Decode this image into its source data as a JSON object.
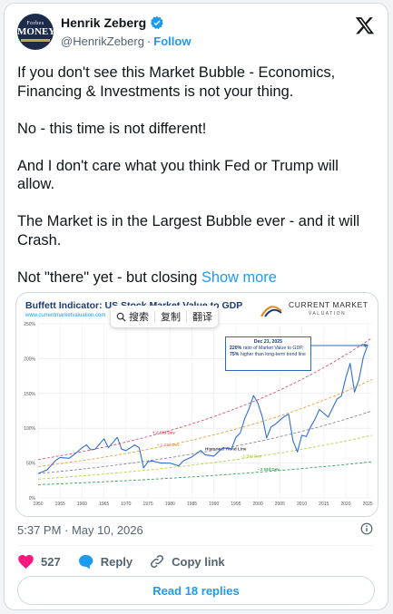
{
  "author": {
    "name": "Henrik Zeberg",
    "handle": "@HenrikZeberg",
    "separator": "·",
    "follow_label": "Follow",
    "avatar_text_top": "Forbes",
    "avatar_text_main": "MONEY"
  },
  "tweet": {
    "paragraphs": [
      "If you don't see this Market Bubble - Economics, Financing & Investments is not your thing.",
      "No - this time is not different!",
      "And I don't care what you think Fed or Trump will allow.",
      "The Market is in the Largest Bubble ever - and it will Crash."
    ],
    "last_line": "Not \"there\" yet - but closing",
    "show_more": "Show more"
  },
  "media": {
    "title": "Buffett Indicator: US Stock Market Value to GDP",
    "url": "www.currentmarketvaluation.com",
    "logo_line1": "CURRENT MARKET",
    "logo_line2": "VALUATION",
    "popup": {
      "search": "搜索",
      "copy": "复制",
      "translate": "翻译"
    },
    "annotation": {
      "date": "Dec 21, 2025",
      "line1_bold": "220%",
      "line1_rest": " ratio of Market Value to GDP,",
      "line2_bold": "75%",
      "line2_rest": " higher than long-term trend line"
    }
  },
  "chart_data": {
    "type": "line",
    "title": "Buffett Indicator: US Stock Market Value to GDP",
    "xlim": [
      1950,
      2026
    ],
    "ylim": [
      0,
      250
    ],
    "x_ticks": [
      "1950",
      "1955",
      "1960",
      "1965",
      "1970",
      "1975",
      "1980",
      "1985",
      "1990",
      "1995",
      "2000",
      "2005",
      "2010",
      "2015",
      "2020",
      "2025"
    ],
    "y_ticks": [
      "0%",
      "50%",
      "100%",
      "150%",
      "200%",
      "250%"
    ],
    "grid": true,
    "bands": [
      {
        "name": "+ 2 Std Dev",
        "color": "#d9536b",
        "start": 55,
        "end": 230
      },
      {
        "name": "+ 1 Std Dev",
        "color": "#e8a03a",
        "start": 45,
        "end": 170
      },
      {
        "name": "Historical Trend Line",
        "color": "#888888",
        "start": 35,
        "end": 125
      },
      {
        "name": "- 1 Std Dev",
        "color": "#b6cf4a",
        "start": 27,
        "end": 90
      },
      {
        "name": "- 2 Std Dev",
        "color": "#3aa05a",
        "start": 19,
        "end": 52
      }
    ],
    "series": [
      {
        "color": "#2f6fd1",
        "x": [
          1950,
          1952,
          1954,
          1955,
          1957,
          1958,
          1960,
          1961,
          1962,
          1963,
          1965,
          1966,
          1968,
          1969,
          1970,
          1972,
          1973,
          1974,
          1975,
          1976,
          1978,
          1980,
          1982,
          1983,
          1985,
          1987,
          1988,
          1990,
          1992,
          1994,
          1995,
          1996,
          1997,
          1998,
          1999,
          2000,
          2001,
          2002,
          2003,
          2004,
          2006,
          2007,
          2008,
          2009,
          2010,
          2011,
          2012,
          2013,
          2014,
          2016,
          2018,
          2019,
          2020,
          2021,
          2022,
          2023,
          2024,
          2025
        ],
        "y": [
          35,
          42,
          52,
          60,
          55,
          63,
          70,
          78,
          67,
          72,
          83,
          74,
          85,
          72,
          66,
          78,
          70,
          45,
          50,
          55,
          48,
          52,
          44,
          55,
          57,
          70,
          60,
          62,
          70,
          72,
          85,
          95,
          112,
          130,
          145,
          138,
          115,
          88,
          100,
          108,
          115,
          122,
          80,
          68,
          88,
          90,
          100,
          115,
          125,
          118,
          140,
          148,
          170,
          195,
          150,
          172,
          200,
          220
        ]
      }
    ]
  },
  "footer": {
    "timestamp": "5:37 PM · May 10, 2026",
    "likes": "527",
    "reply_label": "Reply",
    "copy_link_label": "Copy link",
    "read_replies": "Read 18 replies"
  },
  "colors": {
    "accent": "#1d9bf0",
    "like": "#f91880",
    "text": "#0f1419",
    "muted": "#536471"
  }
}
